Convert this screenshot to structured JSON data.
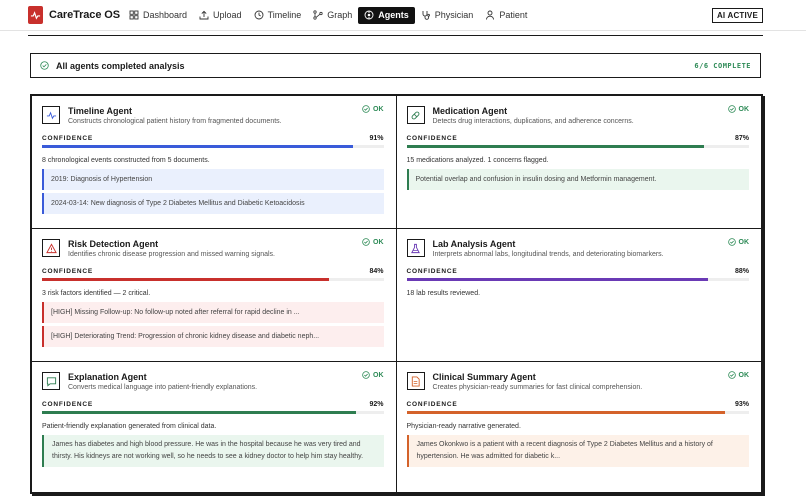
{
  "app": {
    "name": "CareTrace OS"
  },
  "nav": [
    {
      "label": "Dashboard",
      "icon": "dashboard-icon",
      "active": false
    },
    {
      "label": "Upload",
      "icon": "upload-icon",
      "active": false
    },
    {
      "label": "Timeline",
      "icon": "clock-icon",
      "active": false
    },
    {
      "label": "Graph",
      "icon": "graph-icon",
      "active": false
    },
    {
      "label": "Agents",
      "icon": "agents-icon",
      "active": true
    },
    {
      "label": "Physician",
      "icon": "stethoscope-icon",
      "active": false
    },
    {
      "label": "Patient",
      "icon": "person-icon",
      "active": false
    }
  ],
  "ai_status": "AI ACTIVE",
  "status_banner": {
    "text": "All agents completed analysis",
    "count": "6/6 COMPLETE"
  },
  "confidence_label": "CONFIDENCE",
  "colors": {
    "ok": "#2e8b57",
    "brand": "#c8302c"
  },
  "agents": [
    {
      "name": "Timeline Agent",
      "icon": "pulse-icon",
      "status": "OK",
      "description": "Constructs chronological patient history from fragmented documents.",
      "confidence_text": "91%",
      "confidence": 0.91,
      "color": "#3a5bd9",
      "tint": "#eaf0fd",
      "summary": "8 chronological events constructed from 5 documents.",
      "findings": [
        "2019: Diagnosis of Hypertension",
        "2024-03-14: New diagnosis of Type 2 Diabetes Mellitus and Diabetic Ketoacidosis"
      ]
    },
    {
      "name": "Medication Agent",
      "icon": "pill-icon",
      "status": "OK",
      "description": "Detects drug interactions, duplications, and adherence concerns.",
      "confidence_text": "87%",
      "confidence": 0.87,
      "color": "#2e7d50",
      "tint": "#eaf6ee",
      "summary": "15 medications analyzed. 1 concerns flagged.",
      "findings": [
        "Potential overlap and confusion in insulin dosing and Metformin management."
      ]
    },
    {
      "name": "Risk Detection Agent",
      "icon": "warning-icon",
      "status": "OK",
      "description": "Identifies chronic disease progression and missed warning signals.",
      "confidence_text": "84%",
      "confidence": 0.84,
      "color": "#c8302c",
      "tint": "#fdeeee",
      "summary": "3 risk factors identified — 2 critical.",
      "findings": [
        "[HIGH] Missing Follow-up: No follow-up noted after referral for rapid decline in ...",
        "[HIGH] Deteriorating Trend: Progression of chronic kidney disease and diabetic neph..."
      ]
    },
    {
      "name": "Lab Analysis Agent",
      "icon": "flask-icon",
      "status": "OK",
      "description": "Interprets abnormal labs, longitudinal trends, and deteriorating biomarkers.",
      "confidence_text": "88%",
      "confidence": 0.88,
      "color": "#6a3ab5",
      "tint": "#f2edfb",
      "summary": "18 lab results reviewed.",
      "findings": []
    },
    {
      "name": "Explanation Agent",
      "icon": "chat-icon",
      "status": "OK",
      "description": "Converts medical language into patient-friendly explanations.",
      "confidence_text": "92%",
      "confidence": 0.92,
      "color": "#2e7d50",
      "tint": "#eaf6ee",
      "summary": "Patient-friendly explanation generated from clinical data.",
      "findings": [
        "James has diabetes and high blood pressure. He was in the hospital because he was very tired and thirsty. His kidneys are not working well, so he needs to see a kidney doctor to help him stay healthy."
      ]
    },
    {
      "name": "Clinical Summary Agent",
      "icon": "document-icon",
      "status": "OK",
      "description": "Creates physician-ready summaries for fast clinical comprehension.",
      "confidence_text": "93%",
      "confidence": 0.93,
      "color": "#d4622a",
      "tint": "#fdf1e8",
      "summary": "Physician-ready narrative generated.",
      "findings": [
        "James Okonkwo is a patient with a recent diagnosis of Type 2 Diabetes Mellitus and a history of hypertension. He was admitted for diabetic k..."
      ]
    }
  ]
}
